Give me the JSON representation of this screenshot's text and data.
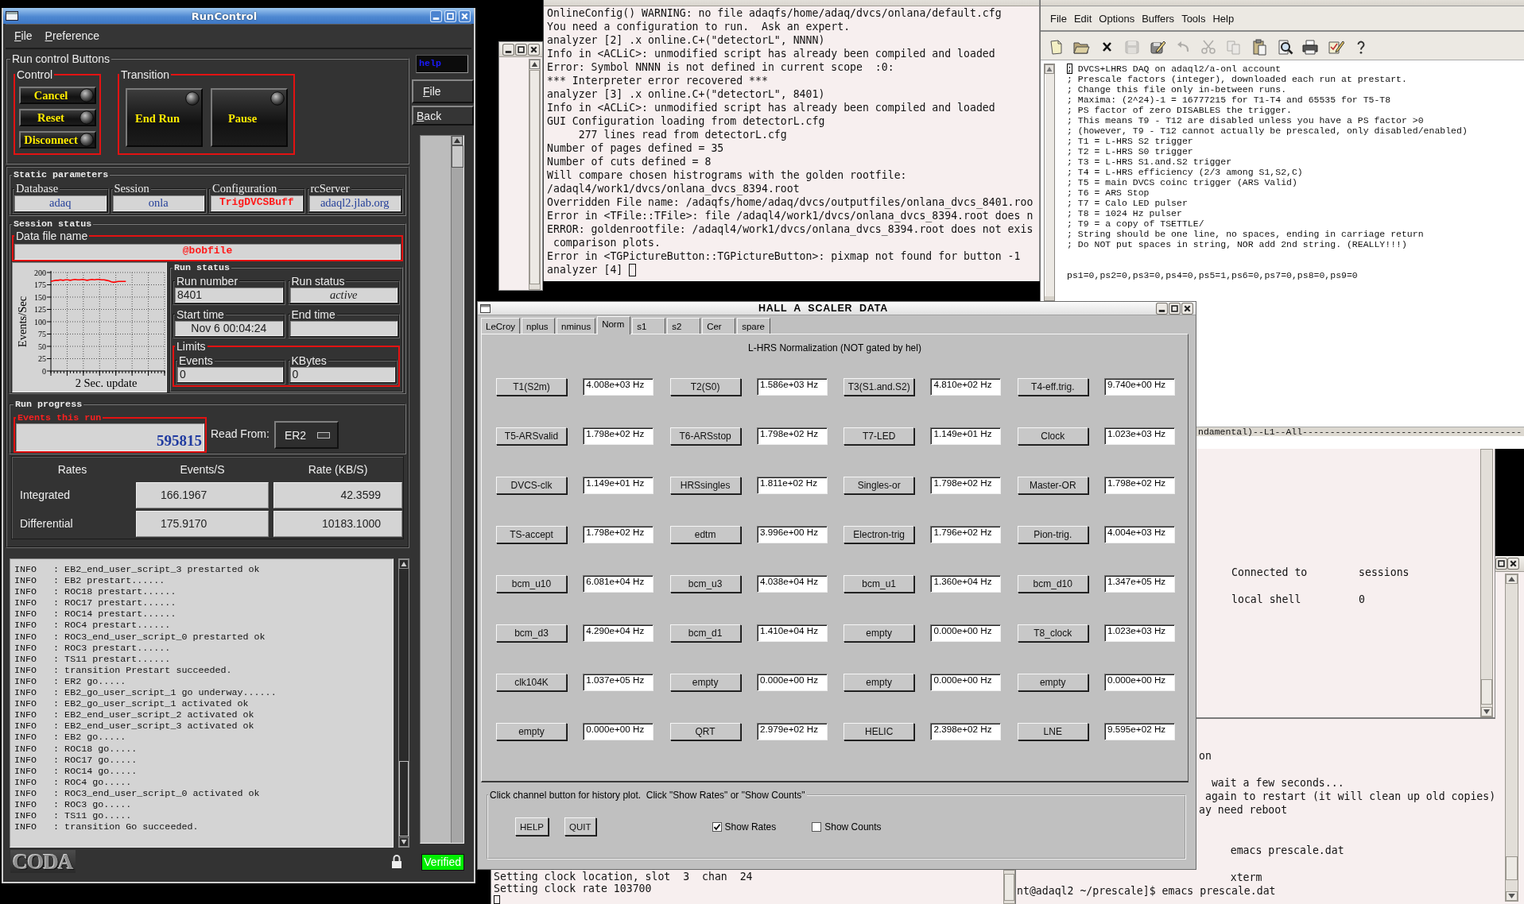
{
  "run_control": {
    "title": "RunControl",
    "menu": [
      "File",
      "Preference"
    ],
    "run_buttons": {
      "title": "Run control Buttons",
      "groups": [
        {
          "title": "Control",
          "kind": "small",
          "buttons": [
            "Cancel",
            "Reset",
            "Disconnect"
          ]
        },
        {
          "title": "Transition",
          "kind": "large",
          "buttons": [
            "End Run",
            "Pause"
          ]
        }
      ]
    },
    "side": {
      "help": "help",
      "buttons": [
        "File",
        "Back"
      ],
      "status": "Verified"
    },
    "static_parameters": {
      "title": "Static parameters",
      "fields": [
        {
          "label": "Database",
          "value": "adaq",
          "kind": "normal"
        },
        {
          "label": "Session",
          "value": "onla",
          "kind": "normal"
        },
        {
          "label": "Configuration",
          "value": "TrigDVCSBuff",
          "kind": "alert"
        },
        {
          "label": "rcServer",
          "value": "adaql2.jlab.org",
          "kind": "normal"
        }
      ]
    },
    "session_status": {
      "title": "Session status",
      "data_file": {
        "label": "Data file name",
        "value": "@bobfile"
      },
      "chart_data": {
        "type": "line",
        "xlabel": "2 Sec. update",
        "ylabel": "Events/Sec",
        "ylim": [
          0,
          200
        ],
        "yticks": [
          0,
          25,
          50,
          75,
          100,
          125,
          150,
          175,
          200
        ],
        "grid": true,
        "series": [
          {
            "color": "#ff0000",
            "values": [
              182,
              183,
              184,
              184,
              185,
              184,
              185,
              185,
              184,
              185,
              186,
              185,
              185,
              186,
              185,
              184,
              185,
              186,
              185,
              186,
              186,
              185,
              185,
              184,
              183,
              181,
              180,
              181,
              182,
              182,
              182,
              182,
              null,
              null,
              null,
              null,
              null,
              null,
              null,
              null,
              null,
              null,
              null,
              null,
              null,
              null,
              null,
              null
            ]
          }
        ]
      },
      "run_status": {
        "title": "Run status",
        "fields": [
          {
            "label": "Run number",
            "value": "8401",
            "kind": "left"
          },
          {
            "label": "Run status",
            "value": "active",
            "kind": "italic"
          },
          {
            "label": "Start time",
            "value": "Nov 6 00:04:24",
            "kind": "center"
          },
          {
            "label": "End time",
            "kind": "center"
          }
        ],
        "limits": {
          "title": "Limits",
          "fields": [
            {
              "label": "Events",
              "value": "0",
              "kind": "left"
            },
            {
              "label": "KBytes",
              "value": "0",
              "kind": "left"
            }
          ]
        }
      }
    },
    "run_progress": {
      "title": "Run progress",
      "events": {
        "label": "Events this run",
        "value": "595815"
      },
      "read_from": {
        "label": "Read From:",
        "value": "ER2"
      }
    },
    "rates": {
      "columns": [
        "Rates",
        "Events/S",
        "Rate (KB/S)"
      ],
      "rows": [
        {
          "label": "Integrated",
          "events": "166.1967",
          "rate": "42.3599"
        },
        {
          "label": "Differential",
          "events": "175.9170",
          "rate": "10183.1000"
        }
      ]
    },
    "log": [
      "INFO   : EB2_end_user_script_3 prestarted ok",
      "INFO   : EB2 prestart......",
      "INFO   : ROC18 prestart......",
      "INFO   : ROC17 prestart......",
      "INFO   : ROC14 prestart......",
      "INFO   : ROC4 prestart......",
      "INFO   : ROC3_end_user_script_0 prestarted ok",
      "INFO   : ROC3 prestart......",
      "INFO   : TS11 prestart......",
      "INFO   : transition Prestart succeeded.",
      "INFO   : ER2 go.....",
      "INFO   : EB2_go_user_script_1 go underway......",
      "INFO   : EB2_go_user_script_1 activated ok",
      "INFO   : EB2_end_user_script_2 activated ok",
      "INFO   : EB2_end_user_script_3 activated ok",
      "INFO   : EB2 go.....",
      "INFO   : ROC18 go.....",
      "INFO   : ROC17 go.....",
      "INFO   : ROC14 go.....",
      "INFO   : ROC4 go.....",
      "INFO   : ROC3_end_user_script_0 activated ok",
      "INFO   : ROC3 go.....",
      "INFO   : TS11 go.....",
      "INFO   : transition Go succeeded."
    ],
    "logo": "CODA"
  },
  "analyzer_terminal": {
    "lines": [
      "OnlineConfig() WARNING: no file adaqfs/home/adaq/dvcs/onlana/default.cfg",
      "You need a configuration to run.  Ask an expert.",
      "analyzer [2] .x online.C+(\"detectorL\", NNNN)",
      "Info in <ACLiC>: unmodified script has already been compiled and loaded",
      "Error: Symbol NNNN is not defined in current scope  :0:",
      "*** Interpreter error recovered ***",
      "analyzer [3] .x online.C+(\"detectorL\", 8401)",
      "Info in <ACLiC>: unmodified script has already been compiled and loaded",
      "GUI Configuration loading from detectorL.cfg",
      "     277 lines read from detectorL.cfg",
      "Number of pages defined = 35",
      "Number of cuts defined = 8",
      "Will compare chosen histrograms with the golden rootfile:",
      "/adaql4/work1/dvcs/onlana_dvcs_8394.root",
      "Overridden File name: /adaqfs/home/adaq/dvcs/outputfiles/onlana_dvcs_8401.roo",
      "Error in <TFile::TFile>: file /adaql4/work1/dvcs/onlana_dvcs_8394.root does n",
      "ERROR: goldenrootfile: /adaql4/work1/dvcs/onlana_dvcs_8394.root does not exis",
      " comparison plots.",
      "Error in <TGPictureButton::TGPictureButton>: pixmap not found for button -1",
      "analyzer [4]"
    ],
    "cursor": true
  },
  "emacs": {
    "menu": [
      "File",
      "Edit",
      "Options",
      "Buffers",
      "Tools",
      "Help"
    ],
    "toolbar": [
      {
        "kind": "new",
        "disabled": false
      },
      {
        "kind": "open",
        "disabled": false
      },
      {
        "kind": "close",
        "disabled": false
      },
      {
        "kind": "save",
        "disabled": true
      },
      {
        "kind": "saveas",
        "disabled": false
      },
      {
        "kind": "undo",
        "disabled": true
      },
      {
        "kind": "cut",
        "disabled": true
      },
      {
        "kind": "copy",
        "disabled": true
      },
      {
        "kind": "paste",
        "disabled": false
      },
      {
        "kind": "search",
        "disabled": false
      },
      {
        "kind": "print",
        "disabled": false
      },
      {
        "kind": "spell",
        "disabled": false
      },
      {
        "kind": "help",
        "disabled": false
      }
    ],
    "cursor": true,
    "blocks": [
      [
        "; DVCS+LHRS DAQ on adaql2/a-onl account",
        "; Prescale factors (integer), downloaded each run at prestart.",
        "; Change this file only in-between runs.",
        "; Maxima: (2^24)-1 = 16777215 for T1-T4 and 65535 for T5-T8",
        "; PS factor of zero DISABLES the trigger.",
        "; This means T9 - T12 are disabled unless you have a PS factor >0",
        "; (however, T9 - T12 cannot actually be prescaled, only disabled/enabled)",
        "; T1 = L-HRS S2 trigger",
        "; T2 = L-HRS S0 trigger",
        "; T3 = L-HRS S1.and.S2 trigger",
        "; T4 = L-HRS efficiency (2/3 among S1,S2,C)",
        "; T5 = main DVCS coinc trigger (ARS Valid)",
        "; T6 = ARS Stop",
        "; T7 = Calo LED pulser",
        "; T8 = 1024 Hz pulser",
        "; T9 = a copy of TSETTLE/",
        "; String should be one line, no spaces, ending in carriage return",
        "; Do NOT put spaces in string, NOR add 2nd string. (REALLY!!!)"
      ],
      [
        "ps1=0,ps2=0,ps3=0,ps4=0,ps5=1,ps6=0,ps7=0,ps8=0,ps9=0"
      ]
    ],
    "mode_line": "ndamental)--L1--All----------------------------------------"
  },
  "scaler": {
    "title": "HALL  A  SCALER  DATA",
    "tabs": [
      {
        "label": "LeCroy",
        "selected": false
      },
      {
        "label": "nplus",
        "selected": false
      },
      {
        "label": "nminus",
        "selected": false
      },
      {
        "label": "Norm",
        "selected": true
      },
      {
        "label": "s1",
        "selected": false
      },
      {
        "label": "s2",
        "selected": false
      },
      {
        "label": "Cer",
        "selected": false
      },
      {
        "label": "spare",
        "selected": false
      }
    ],
    "heading": "L-HRS Normalization (NOT gated by hel)",
    "channels": [
      {
        "name": "T1(S2m)",
        "rate": "4.008e+03 Hz"
      },
      {
        "name": "T2(S0)",
        "rate": "1.586e+03 Hz"
      },
      {
        "name": "T3(S1.and.S2)",
        "rate": "4.810e+02 Hz"
      },
      {
        "name": "T4-eff.trig.",
        "rate": "9.740e+00 Hz"
      },
      {
        "name": "T5-ARSvalid",
        "rate": "1.798e+02 Hz"
      },
      {
        "name": "T6-ARSstop",
        "rate": "1.798e+02 Hz"
      },
      {
        "name": "T7-LED",
        "rate": "1.149e+01 Hz"
      },
      {
        "name": "Clock",
        "rate": "1.023e+03 Hz"
      },
      {
        "name": "DVCS-clk",
        "rate": "1.149e+01 Hz"
      },
      {
        "name": "HRSsingles",
        "rate": "1.811e+02 Hz"
      },
      {
        "name": "Singles-or",
        "rate": "1.798e+02 Hz"
      },
      {
        "name": "Master-OR",
        "rate": "1.798e+02 Hz"
      },
      {
        "name": "TS-accept",
        "rate": "1.798e+02 Hz"
      },
      {
        "name": "edtm",
        "rate": "3.996e+00 Hz"
      },
      {
        "name": "Electron-trig",
        "rate": "1.796e+02 Hz"
      },
      {
        "name": "Pion-trig.",
        "rate": "4.004e+03 Hz"
      },
      {
        "name": "bcm_u10",
        "rate": "6.081e+04 Hz"
      },
      {
        "name": "bcm_u3",
        "rate": "4.038e+04 Hz"
      },
      {
        "name": "bcm_u1",
        "rate": "1.360e+04 Hz"
      },
      {
        "name": "bcm_d10",
        "rate": "1.347e+05 Hz"
      },
      {
        "name": "bcm_d3",
        "rate": "4.290e+04 Hz"
      },
      {
        "name": "bcm_d1",
        "rate": "1.410e+04 Hz"
      },
      {
        "name": "empty",
        "rate": "0.000e+00 Hz"
      },
      {
        "name": "T8_clock",
        "rate": "1.023e+03 Hz"
      },
      {
        "name": "clk104K",
        "rate": "1.037e+05 Hz"
      },
      {
        "name": "empty",
        "rate": "0.000e+00 Hz"
      },
      {
        "name": "empty",
        "rate": "0.000e+00 Hz"
      },
      {
        "name": "empty",
        "rate": "0.000e+00 Hz"
      },
      {
        "name": "empty",
        "rate": "0.000e+00 Hz"
      },
      {
        "name": "QRT",
        "rate": "2.979e+02 Hz"
      },
      {
        "name": "HELIC",
        "rate": "2.398e+02 Hz"
      },
      {
        "name": "LNE",
        "rate": "9.595e+02 Hz"
      }
    ],
    "footer": {
      "title": "Click channel button for history plot.  Click \"Show Rates\" or \"Show Counts\"",
      "buttons": [
        "HELP",
        "QUIT"
      ],
      "options": [
        {
          "label": "Show Rates",
          "checked": true
        },
        {
          "label": "Show Counts",
          "checked": false
        }
      ]
    }
  },
  "session_window": {
    "rows": [
      {
        "label": "Connected to",
        "value": "sessions"
      },
      {
        "label": "local shell",
        "value": "0"
      }
    ]
  },
  "shell_terminal": {
    "blocks": [
      [
        "on"
      ],
      [
        "  wait a few seconds...",
        " again to restart (it will clean up old copies)",
        "ay need reboot"
      ],
      [
        "     emacs prescale.dat"
      ],
      [
        "     xterm"
      ]
    ],
    "prompt": "nt@adaql2 ~/prescale]$ emacs prescale.dat"
  },
  "clock_terminal": {
    "lines": [
      "Setting clock location, slot  3  chan  24",
      "Setting clock rate 103700"
    ],
    "cursor": true
  }
}
